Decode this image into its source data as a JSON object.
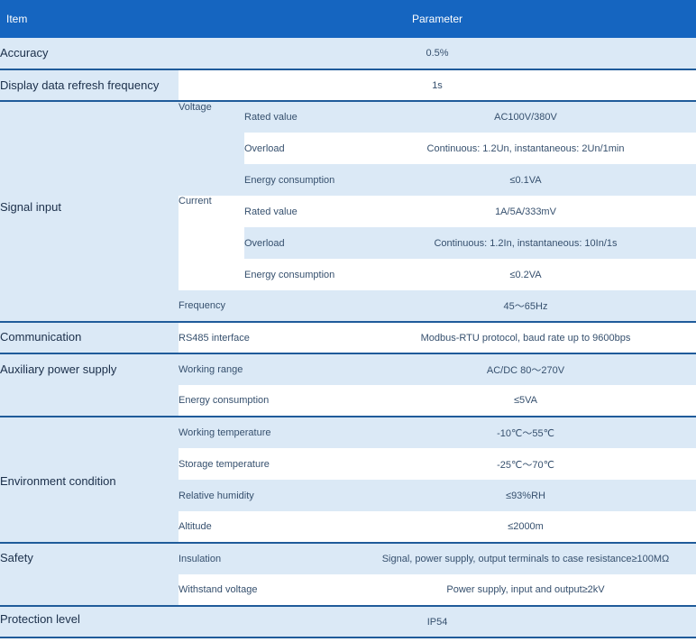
{
  "header": {
    "item": "Item",
    "parameter": "Parameter"
  },
  "rows": {
    "accuracy": {
      "label": "Accuracy",
      "value": "0.5%"
    },
    "refresh": {
      "label": "Display data refresh frequency",
      "value": "1s"
    },
    "signal": {
      "label": "Signal input",
      "voltage": {
        "label": "Voltage",
        "rated_label": "Rated value",
        "rated": "AC100V/380V",
        "overload_label": "Overload",
        "overload": "Continuous: 1.2Un, instantaneous: 2Un/1min",
        "energy_label": "Energy consumption",
        "energy": "≤0.1VA"
      },
      "current": {
        "label": "Current",
        "rated_label": "Rated value",
        "rated": "1A/5A/333mV",
        "overload_label": "Overload",
        "overload": "Continuous: 1.2In, instantaneous: 10In/1s",
        "energy_label": "Energy consumption",
        "energy": "≤0.2VA"
      },
      "frequency": {
        "label": "Frequency",
        "value": "45～65Hz"
      }
    },
    "communication": {
      "label": "Communication",
      "sub": "RS485 interface",
      "value": "Modbus-RTU protocol, baud rate up to 9600bps"
    },
    "aux_power": {
      "label": "Auxiliary power supply",
      "range_label": "Working range",
      "range": "AC/DC 80～270V",
      "energy_label": "Energy consumption",
      "energy": "≤5VA"
    },
    "environment": {
      "label": "Environment condition",
      "work_temp_label": "Working temperature",
      "work_temp": "-10℃～55℃",
      "storage_temp_label": "Storage temperature",
      "storage_temp": "-25℃～70℃",
      "humidity_label": "Relative humidity",
      "humidity": "≤93%RH",
      "altitude_label": "Altitude",
      "altitude": "≤2000m"
    },
    "safety": {
      "label": "Safety",
      "insulation_label": "Insulation",
      "insulation": "Signal, power supply, output terminals to case resistance≥100MΩ",
      "withstand_label": "Withstand voltage",
      "withstand": "Power supply, input and output≥2kV"
    },
    "protection": {
      "label": "Protection level",
      "value": "IP54"
    }
  }
}
